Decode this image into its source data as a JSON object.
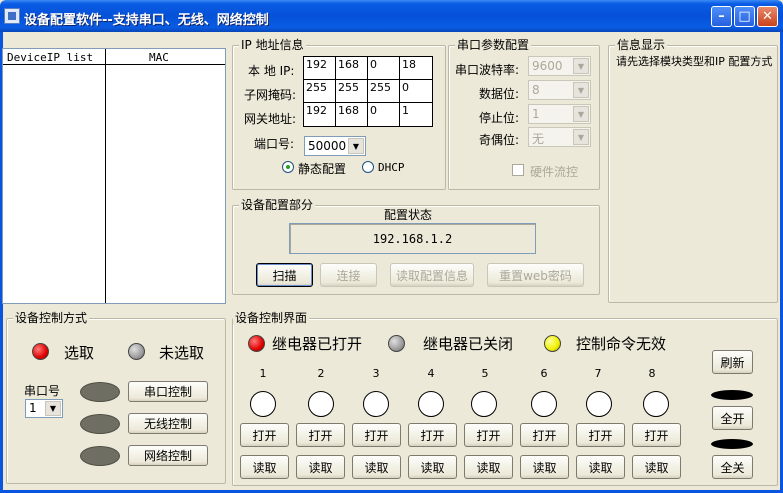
{
  "window": {
    "title": "设备配置软件--支持串口、无线、网络控制",
    "min_glyph": "–",
    "max_glyph": "□",
    "close_glyph": "✕"
  },
  "device_list": {
    "col_ip": "DeviceIP list",
    "col_mac": "MAC"
  },
  "ip_info": {
    "title": "IP 地址信息",
    "local_ip_label": "本 地 IP:",
    "subnet_label": "子网掩码:",
    "gateway_label": "网关地址:",
    "local_ip": [
      "192",
      "168",
      "0",
      "18"
    ],
    "subnet": [
      "255",
      "255",
      "255",
      "0"
    ],
    "gateway": [
      "192",
      "168",
      "0",
      "1"
    ],
    "port_label": "端口号:",
    "port_value": "50000",
    "static_label": "静态配置",
    "dhcp_label": "DHCP"
  },
  "serial": {
    "title": "串口参数配置",
    "baud_label": "串口波特率:",
    "baud_value": "9600",
    "data_bits_label": "数据位:",
    "data_bits_value": "8",
    "stop_bits_label": "停止位:",
    "stop_bits_value": "1",
    "parity_label": "奇偶位:",
    "parity_value": "无",
    "flow_label": "硬件流控"
  },
  "info": {
    "title": "信息显示",
    "message": "请先选择模块类型和IP 配置方式"
  },
  "config": {
    "title": "设备配置部分",
    "status_label": "配置状态",
    "status_value": "192.168.1.2",
    "scan": "扫描",
    "connect": "连接",
    "read_config": "读取配置信息",
    "reset_web": "重置web密码"
  },
  "control_mode": {
    "title": "设备控制方式",
    "selected_label": "选取",
    "unselected_label": "未选取",
    "serial_port_label": "串口号",
    "serial_port_value": "1",
    "serial_control": "串口控制",
    "wireless_control": "无线控制",
    "network_control": "网络控制"
  },
  "control_ui": {
    "title": "设备控制界面",
    "legend_on": "继电器已打开",
    "legend_off": "继电器已关闭",
    "legend_invalid": "控制命令无效",
    "open_label": "打开",
    "read_label": "读取",
    "relays": [
      "1",
      "2",
      "3",
      "4",
      "5",
      "6",
      "7",
      "8"
    ],
    "refresh": "刷新",
    "all_on": "全开",
    "all_off": "全关"
  }
}
